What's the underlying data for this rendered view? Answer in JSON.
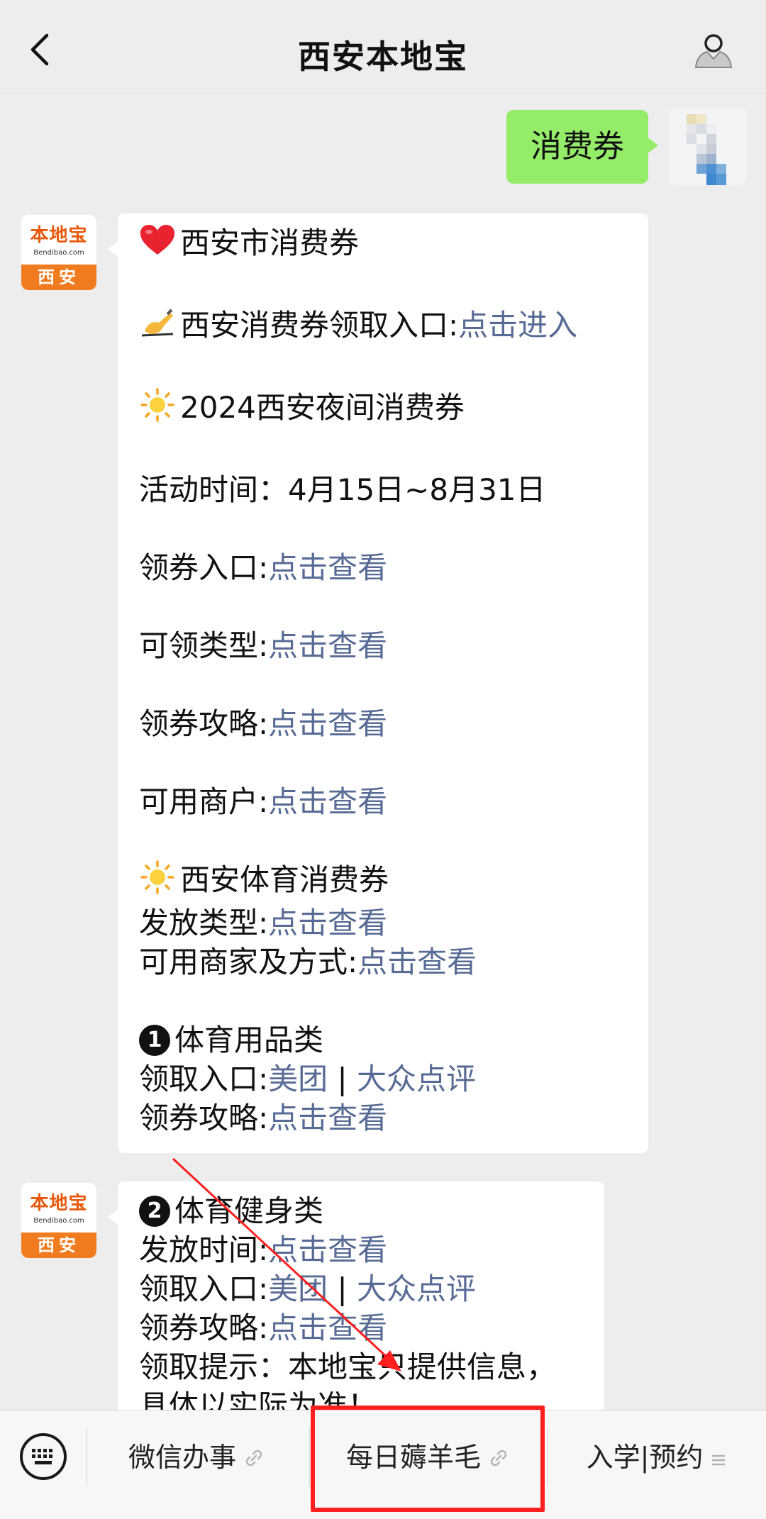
{
  "navbar": {
    "title": "西安本地宝"
  },
  "me": {
    "message": "消费券"
  },
  "bot": {
    "avatar_name": "本地宝",
    "avatar_domain": "Bendibao.com",
    "avatar_city": "西安",
    "msg1": {
      "l1": "西安市消费券",
      "l2_label": "西安消费券领取入口:",
      "l2_link": "点击进入",
      "l3": "2024西安夜间消费券",
      "l4": "活动时间：4月15日~8月31日",
      "l5_label": "领券入口:",
      "l5_link": "点击查看",
      "l6_label": "可领类型:",
      "l6_link": "点击查看",
      "l7_label": "领券攻略:",
      "l7_link": "点击查看",
      "l8_label": "可用商户:",
      "l8_link": "点击查看",
      "l9": "西安体育消费券",
      "l10_label": "发放类型:",
      "l10_link": "点击查看",
      "l11_label": "可用商家及方式:",
      "l11_link": "点击查看",
      "l12_num": "1",
      "l12": "体育用品类",
      "l13_label": "领取入口:",
      "l13_link_a": "美团",
      "l13_sep": " | ",
      "l13_link_b": "大众点评",
      "l14_label": "领券攻略:",
      "l14_link": "点击查看"
    },
    "msg2": {
      "l1_num": "2",
      "l1": "体育健身类",
      "l2_label": "发放时间:",
      "l2_link": "点击查看",
      "l3_label": "领取入口:",
      "l3_link_a": "美团",
      "l3_sep": " | ",
      "l3_link_b": "大众点评",
      "l4_label": "领券攻略:",
      "l4_link": "点击查看",
      "l5": "领取提示：本地宝只提供信息，",
      "l6": "具体以实际为准！"
    }
  },
  "menu": {
    "item1": "微信办事",
    "item2": "每日薅羊毛",
    "item3": "入学|预约"
  },
  "colors": {
    "link": "#576b95",
    "bubble_me": "#95ec69",
    "highlight": "#ff1f1f",
    "brand_orange": "#f07c1f"
  }
}
